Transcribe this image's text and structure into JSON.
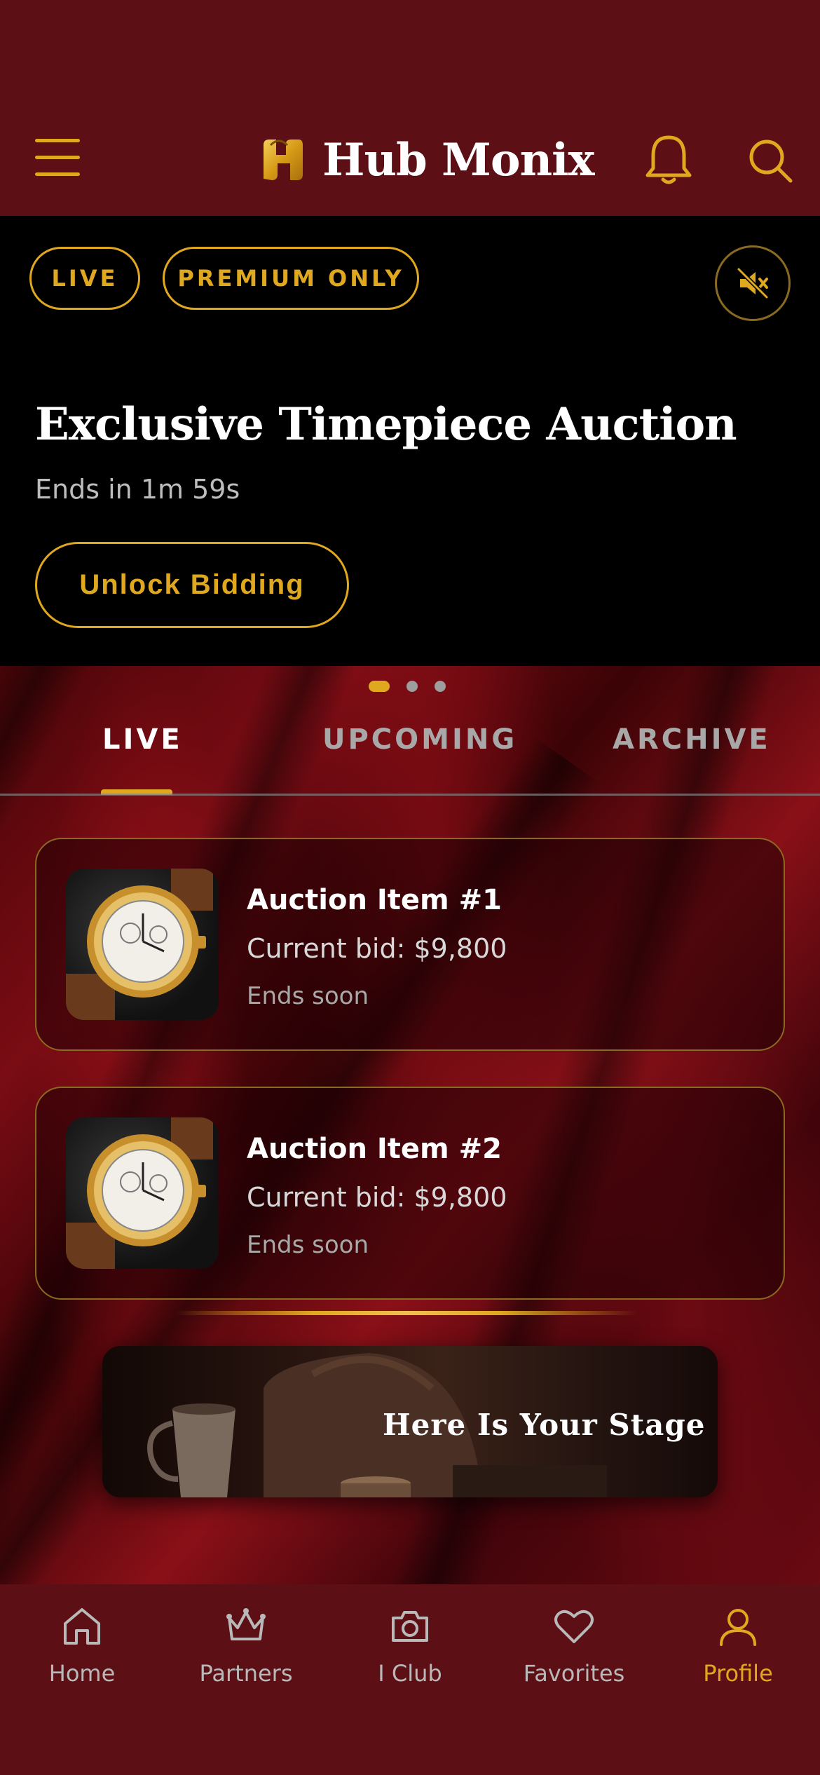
{
  "app": {
    "name": "Hub Monix"
  },
  "colors": {
    "accent": "#e0a81e",
    "background": "#5c0f14",
    "hero_bg": "#000000"
  },
  "header": {
    "menu_icon": "hamburger-menu-icon",
    "logo_icon": "hub-monix-logo",
    "notifications_icon": "bell-icon",
    "search_icon": "search-icon"
  },
  "hero": {
    "badges": [
      "LIVE",
      "PREMIUM ONLY"
    ],
    "mute_icon": "speaker-muted-icon",
    "title": "Exclusive Timepiece Auction",
    "subtitle": "Ends in 1m 59s",
    "cta_label": "Unlock Bidding",
    "carousel_pages": 3,
    "carousel_active_index": 0
  },
  "tabs": {
    "items": [
      "LIVE",
      "UPCOMING",
      "ARCHIVE"
    ],
    "active": "LIVE"
  },
  "auction_items": [
    {
      "title": "Auction Item #1",
      "bid": "Current bid: $9,800",
      "status": "Ends soon",
      "image_icon": "gold-watch-image"
    },
    {
      "title": "Auction Item #2",
      "bid": "Current bid: $9,800",
      "status": "Ends soon",
      "image_icon": "gold-watch-image"
    }
  ],
  "promo": {
    "title": "Here Is Your Stage"
  },
  "bottom_nav": {
    "items": [
      {
        "label": "Home",
        "icon": "home-icon"
      },
      {
        "label": "Partners",
        "icon": "crown-icon"
      },
      {
        "label": "I Club",
        "icon": "camera-icon"
      },
      {
        "label": "Favorites",
        "icon": "heart-icon"
      },
      {
        "label": "Profile",
        "icon": "user-icon"
      }
    ],
    "active": "Profile"
  }
}
